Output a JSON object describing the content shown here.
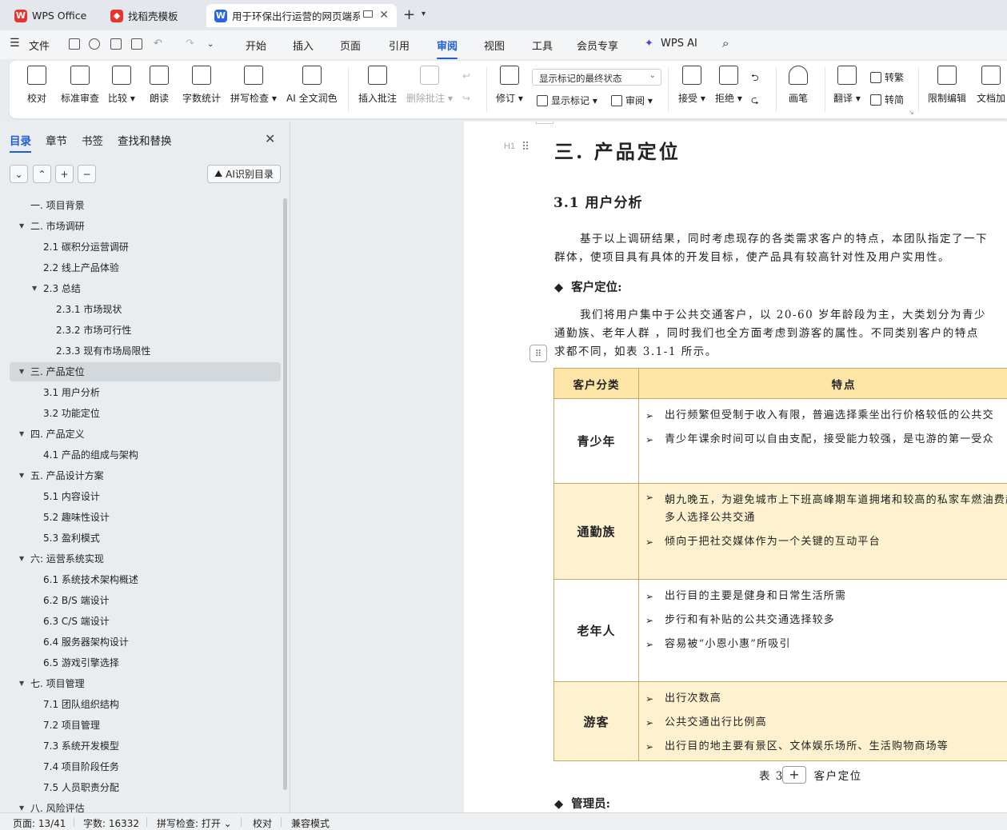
{
  "tabs": [
    {
      "label": "WPS Office",
      "logo": "W",
      "color": "#e8352c"
    },
    {
      "label": "找稻壳模板",
      "logo": "◆",
      "color": "#e8352c"
    },
    {
      "label": "用于环保出行运营的网页端系",
      "logo": "W",
      "color": "#2864e8"
    }
  ],
  "menu": {
    "file": "文件",
    "items": [
      "开始",
      "插入",
      "页面",
      "引用",
      "审阅",
      "视图",
      "工具",
      "会员专享"
    ],
    "active": "审阅",
    "ai": "WPS AI"
  },
  "ribbon": {
    "proofread": "校对",
    "standard_review": "标准审查",
    "compare": "比较",
    "read_aloud": "朗读",
    "word_count": "字数统计",
    "spell_check": "拼写检查",
    "ai_polish": "AI 全文润色",
    "insert_comment": "插入批注",
    "delete_comment": "删除批注",
    "revise": "修订",
    "display_select": "显示标记的最终状态",
    "show_marks": "显示标记",
    "review": "审阅",
    "accept": "接受",
    "reject": "拒绝",
    "brush": "画笔",
    "translate": "翻译",
    "to_traditional": "转繁",
    "to_simplified": "转简",
    "restrict_edit": "限制编辑",
    "doc_encrypt": "文档加"
  },
  "panel": {
    "tabs": [
      "目录",
      "章节",
      "书签",
      "查找和替换"
    ],
    "ai_toc": "AI识别目录",
    "toc": [
      {
        "label": "一. 项目背景",
        "level": 1,
        "arrow": ""
      },
      {
        "label": "二. 市场调研",
        "level": 1,
        "arrow": "▼"
      },
      {
        "label": "2.1  碳积分运营调研",
        "level": 2,
        "arrow": ""
      },
      {
        "label": "2.2  线上产品体验",
        "level": 2,
        "arrow": ""
      },
      {
        "label": "2.3  总结",
        "level": 2,
        "arrow": "▼"
      },
      {
        "label": "2.3.1  市场现状",
        "level": 3,
        "arrow": ""
      },
      {
        "label": "2.3.2  市场可行性",
        "level": 3,
        "arrow": ""
      },
      {
        "label": "2.3.3  现有市场局限性",
        "level": 3,
        "arrow": ""
      },
      {
        "label": "三. 产品定位",
        "level": 1,
        "arrow": "▼",
        "selected": true
      },
      {
        "label": "3.1  用户分析",
        "level": 2,
        "arrow": ""
      },
      {
        "label": "3.2  功能定位",
        "level": 2,
        "arrow": ""
      },
      {
        "label": "四. 产品定义",
        "level": 1,
        "arrow": "▼"
      },
      {
        "label": "4.1  产品的组成与架构",
        "level": 2,
        "arrow": ""
      },
      {
        "label": "五. 产品设计方案",
        "level": 1,
        "arrow": "▼"
      },
      {
        "label": "5.1 内容设计",
        "level": 2,
        "arrow": ""
      },
      {
        "label": "5.2  趣味性设计",
        "level": 2,
        "arrow": ""
      },
      {
        "label": "5.3  盈利模式",
        "level": 2,
        "arrow": ""
      },
      {
        "label": "六: 运营系统实现",
        "level": 1,
        "arrow": "▼"
      },
      {
        "label": "6.1  系统技术架构概述",
        "level": 2,
        "arrow": ""
      },
      {
        "label": "6.2 B/S 端设计",
        "level": 2,
        "arrow": ""
      },
      {
        "label": "6.3 C/S 端设计",
        "level": 2,
        "arrow": ""
      },
      {
        "label": "6.4 服务器架构设计",
        "level": 2,
        "arrow": ""
      },
      {
        "label": "6.5 游戏引擎选择",
        "level": 2,
        "arrow": ""
      },
      {
        "label": "七. 项目管理",
        "level": 1,
        "arrow": "▼"
      },
      {
        "label": "7.1  团队组织结构",
        "level": 2,
        "arrow": ""
      },
      {
        "label": "7.2  项目管理",
        "level": 2,
        "arrow": ""
      },
      {
        "label": "7.3  系统开发模型",
        "level": 2,
        "arrow": ""
      },
      {
        "label": "7.4  项目阶段任务",
        "level": 2,
        "arrow": ""
      },
      {
        "label": "7.5  人员职责分配",
        "level": 2,
        "arrow": ""
      },
      {
        "label": "八. 风险评估",
        "level": 1,
        "arrow": "▼"
      }
    ]
  },
  "doc": {
    "h1_marker": "H1",
    "h1": "三. 产品定位",
    "h2": "3.1  用户分析",
    "para1": [
      "基于以上调研结果，同时考虑现存的各类需求客户的特点，本团队指定了一下",
      "群体，使项目具有具体的开发目标，使产品具有较高针对性及用户实用性。"
    ],
    "bullet1": "客户定位:",
    "para2": [
      "我们将用户集中于公共交通客户，以 20-60 岁年龄段为主，大类划分为青少",
      "通勤族、老年人群 ，同时我们也全方面考虑到游客的属性。不同类别客户的特点",
      "求都不同，如表 3.1-1 所示。"
    ],
    "table": {
      "head": [
        "客户分类",
        "特点"
      ],
      "rows": [
        {
          "cat": "青少年",
          "items": [
            "出行频繁但受制于收入有限，普遍选择乘坐出行价格较低的公共交",
            "青少年课余时间可以自由支配，接受能力较强，是屯游的第一受众"
          ]
        },
        {
          "cat": "通勤族",
          "items": [
            "朝九晚五，为避免城市上下班高峰期车道拥堵和较高的私家车燃油费越来越多人选择公共交通",
            "倾向于把社交媒体作为一个关键的互动平台"
          ]
        },
        {
          "cat": "老年人",
          "items": [
            "出行目的主要是健身和日常生活所需",
            "步行和有补贴的公共交通选择较多",
            "容易被“小恩小惠”所吸引"
          ]
        },
        {
          "cat": "游客",
          "items": [
            "出行次数高",
            "公共交通出行比例高",
            "出行目的地主要有景区、文体娱乐场所、生活购物商场等"
          ]
        }
      ]
    },
    "caption_pre": "表 3.",
    "caption_post": "客户定位",
    "bullet2": "管理员:"
  },
  "status": {
    "page": "页面: 13/41",
    "words": "字数: 16332",
    "spell": "拼写检查: 打开",
    "proof": "校对",
    "compat": "兼容模式"
  }
}
